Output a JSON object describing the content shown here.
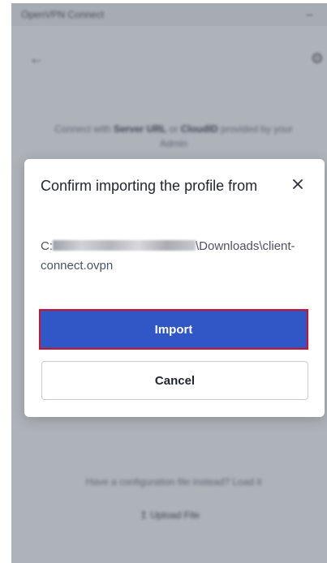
{
  "app": {
    "window_title": "OpenVPN Connect",
    "minimize_glyph": "–"
  },
  "background": {
    "back_icon": "arrow-left-icon",
    "settings_icon": "gear-icon",
    "instruction_prefix": "Connect with",
    "instruction_server": "Server URL",
    "instruction_or": "or",
    "instruction_cloud": "CloudID",
    "instruction_suffix": "provided by your Admin",
    "config_question": "Have a configuration file instead? Load it",
    "upload_label": "Upload File"
  },
  "dialog": {
    "title": "Confirm importing the profile from",
    "close_icon": "close-icon",
    "path_visible_start": "C:",
    "path_visible_end": "\\Downloads\\client-connect.ovpn",
    "import_label": "Import",
    "cancel_label": "Cancel"
  },
  "colors": {
    "import_button": "#3156c5",
    "highlight_border": "#d3102a",
    "overlay": "#464e5c"
  }
}
